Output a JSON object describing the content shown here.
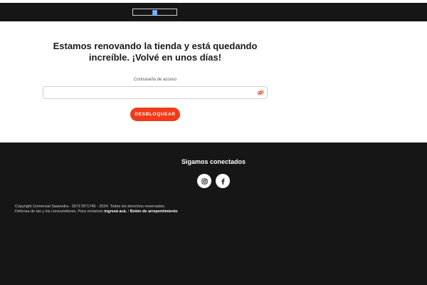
{
  "header": {
    "logo_icon": "store-logo-icon"
  },
  "main": {
    "headline": "Estamos renovando la tienda y está quedando increíble. ¡Volvé en unos días!",
    "password_label": "Contraseña de acceso",
    "password_value": "",
    "password_placeholder": "",
    "eye_icon": "eye-off-icon",
    "unlock_label": "DESBLOQUEAR",
    "accent_color": "#f23a1a"
  },
  "footer": {
    "follow_title": "Sigamos conectados",
    "social": [
      {
        "icon": "instagram-icon"
      },
      {
        "icon": "facebook-icon"
      }
    ],
    "copyright": "Copyright Comercial Saavedra - 30717871746 - 2024. Todos los derechos reservados.",
    "consumer_text": "Defensa de las y los consumidores. Para reclamos",
    "claims_link": "ingresá acá.",
    "separator": "/",
    "regret_button_link": "Botón de arrepentimiento"
  }
}
